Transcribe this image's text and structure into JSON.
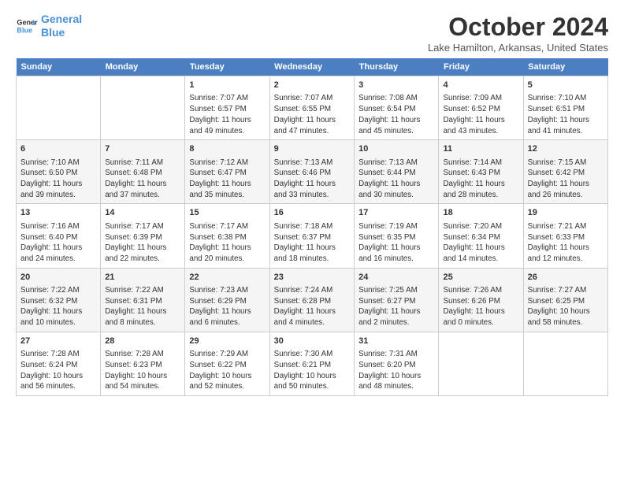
{
  "logo": {
    "line1": "General",
    "line2": "Blue"
  },
  "title": "October 2024",
  "location": "Lake Hamilton, Arkansas, United States",
  "days_header": [
    "Sunday",
    "Monday",
    "Tuesday",
    "Wednesday",
    "Thursday",
    "Friday",
    "Saturday"
  ],
  "weeks": [
    [
      {
        "day": "",
        "info": ""
      },
      {
        "day": "",
        "info": ""
      },
      {
        "day": "1",
        "info": "Sunrise: 7:07 AM\nSunset: 6:57 PM\nDaylight: 11 hours and 49 minutes."
      },
      {
        "day": "2",
        "info": "Sunrise: 7:07 AM\nSunset: 6:55 PM\nDaylight: 11 hours and 47 minutes."
      },
      {
        "day": "3",
        "info": "Sunrise: 7:08 AM\nSunset: 6:54 PM\nDaylight: 11 hours and 45 minutes."
      },
      {
        "day": "4",
        "info": "Sunrise: 7:09 AM\nSunset: 6:52 PM\nDaylight: 11 hours and 43 minutes."
      },
      {
        "day": "5",
        "info": "Sunrise: 7:10 AM\nSunset: 6:51 PM\nDaylight: 11 hours and 41 minutes."
      }
    ],
    [
      {
        "day": "6",
        "info": "Sunrise: 7:10 AM\nSunset: 6:50 PM\nDaylight: 11 hours and 39 minutes."
      },
      {
        "day": "7",
        "info": "Sunrise: 7:11 AM\nSunset: 6:48 PM\nDaylight: 11 hours and 37 minutes."
      },
      {
        "day": "8",
        "info": "Sunrise: 7:12 AM\nSunset: 6:47 PM\nDaylight: 11 hours and 35 minutes."
      },
      {
        "day": "9",
        "info": "Sunrise: 7:13 AM\nSunset: 6:46 PM\nDaylight: 11 hours and 33 minutes."
      },
      {
        "day": "10",
        "info": "Sunrise: 7:13 AM\nSunset: 6:44 PM\nDaylight: 11 hours and 30 minutes."
      },
      {
        "day": "11",
        "info": "Sunrise: 7:14 AM\nSunset: 6:43 PM\nDaylight: 11 hours and 28 minutes."
      },
      {
        "day": "12",
        "info": "Sunrise: 7:15 AM\nSunset: 6:42 PM\nDaylight: 11 hours and 26 minutes."
      }
    ],
    [
      {
        "day": "13",
        "info": "Sunrise: 7:16 AM\nSunset: 6:40 PM\nDaylight: 11 hours and 24 minutes."
      },
      {
        "day": "14",
        "info": "Sunrise: 7:17 AM\nSunset: 6:39 PM\nDaylight: 11 hours and 22 minutes."
      },
      {
        "day": "15",
        "info": "Sunrise: 7:17 AM\nSunset: 6:38 PM\nDaylight: 11 hours and 20 minutes."
      },
      {
        "day": "16",
        "info": "Sunrise: 7:18 AM\nSunset: 6:37 PM\nDaylight: 11 hours and 18 minutes."
      },
      {
        "day": "17",
        "info": "Sunrise: 7:19 AM\nSunset: 6:35 PM\nDaylight: 11 hours and 16 minutes."
      },
      {
        "day": "18",
        "info": "Sunrise: 7:20 AM\nSunset: 6:34 PM\nDaylight: 11 hours and 14 minutes."
      },
      {
        "day": "19",
        "info": "Sunrise: 7:21 AM\nSunset: 6:33 PM\nDaylight: 11 hours and 12 minutes."
      }
    ],
    [
      {
        "day": "20",
        "info": "Sunrise: 7:22 AM\nSunset: 6:32 PM\nDaylight: 11 hours and 10 minutes."
      },
      {
        "day": "21",
        "info": "Sunrise: 7:22 AM\nSunset: 6:31 PM\nDaylight: 11 hours and 8 minutes."
      },
      {
        "day": "22",
        "info": "Sunrise: 7:23 AM\nSunset: 6:29 PM\nDaylight: 11 hours and 6 minutes."
      },
      {
        "day": "23",
        "info": "Sunrise: 7:24 AM\nSunset: 6:28 PM\nDaylight: 11 hours and 4 minutes."
      },
      {
        "day": "24",
        "info": "Sunrise: 7:25 AM\nSunset: 6:27 PM\nDaylight: 11 hours and 2 minutes."
      },
      {
        "day": "25",
        "info": "Sunrise: 7:26 AM\nSunset: 6:26 PM\nDaylight: 11 hours and 0 minutes."
      },
      {
        "day": "26",
        "info": "Sunrise: 7:27 AM\nSunset: 6:25 PM\nDaylight: 10 hours and 58 minutes."
      }
    ],
    [
      {
        "day": "27",
        "info": "Sunrise: 7:28 AM\nSunset: 6:24 PM\nDaylight: 10 hours and 56 minutes."
      },
      {
        "day": "28",
        "info": "Sunrise: 7:28 AM\nSunset: 6:23 PM\nDaylight: 10 hours and 54 minutes."
      },
      {
        "day": "29",
        "info": "Sunrise: 7:29 AM\nSunset: 6:22 PM\nDaylight: 10 hours and 52 minutes."
      },
      {
        "day": "30",
        "info": "Sunrise: 7:30 AM\nSunset: 6:21 PM\nDaylight: 10 hours and 50 minutes."
      },
      {
        "day": "31",
        "info": "Sunrise: 7:31 AM\nSunset: 6:20 PM\nDaylight: 10 hours and 48 minutes."
      },
      {
        "day": "",
        "info": ""
      },
      {
        "day": "",
        "info": ""
      }
    ]
  ]
}
